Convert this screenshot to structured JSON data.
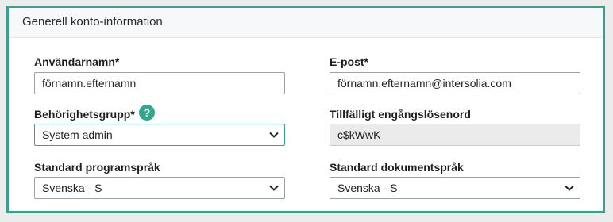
{
  "panel": {
    "title": "Generell konto-information"
  },
  "fields": {
    "username": {
      "label": "Användarnamn*",
      "value": "förnamn.efternamn"
    },
    "email": {
      "label": "E-post*",
      "value": "förnamn.efternamn@intersolia.com"
    },
    "permission_group": {
      "label": "Behörighetsgrupp*",
      "value": "System admin",
      "help_icon": "question-icon"
    },
    "temp_password": {
      "label": "Tillfälligt engångslösenord",
      "value": "c$kWwK"
    },
    "program_language": {
      "label": "Standard programspråk",
      "value": "Svenska - S"
    },
    "document_language": {
      "label": "Standard dokumentspråk",
      "value": "Svenska - S"
    }
  },
  "colors": {
    "accent": "#3a9f8c",
    "help_icon": "#2fa88c"
  }
}
